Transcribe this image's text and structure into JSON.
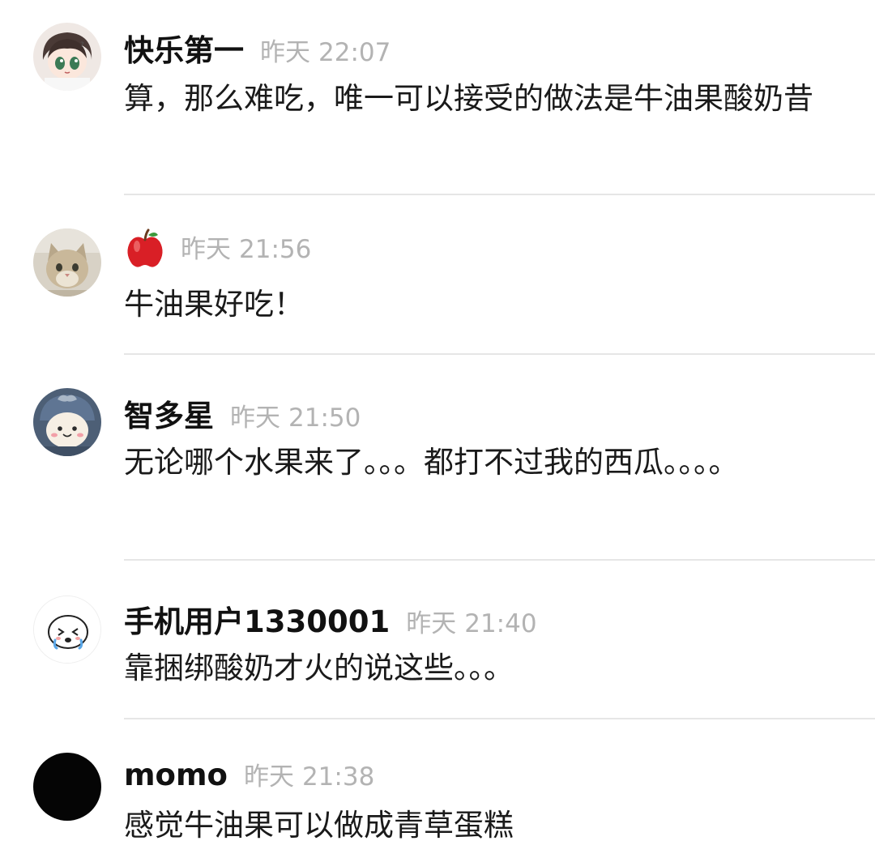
{
  "comments": [
    {
      "username": "快乐第一",
      "avatar": "anime-girl-avatar",
      "date": "昨天",
      "time": "22:07",
      "text": "算，那么难吃，唯一可以接受的做法是牛油果酸奶昔"
    },
    {
      "username": "",
      "username_icon": "red-apple-icon",
      "avatar": "cat-photo-avatar",
      "date": "昨天",
      "time": "21:56",
      "text": "牛油果好吃！"
    },
    {
      "username": "智多星",
      "avatar": "hachiware-plush-avatar",
      "date": "昨天",
      "time": "21:50",
      "text": "无论哪个水果来了。。。都打不过我的西瓜。。。。"
    },
    {
      "username": "手机用户1330001",
      "avatar": "crying-doodle-avatar",
      "date": "昨天",
      "time": "21:40",
      "text": "靠捆绑酸奶才火的说这些。。。"
    },
    {
      "username": "momo",
      "avatar": "black-circle-avatar",
      "date": "昨天",
      "time": "21:38",
      "text": "感觉牛油果可以做成青草蛋糕"
    }
  ],
  "colors": {
    "username": "#111111",
    "timestamp": "#b3b3b3",
    "body": "#1a1a1a",
    "divider": "#e6e6e6",
    "background": "#ffffff"
  }
}
